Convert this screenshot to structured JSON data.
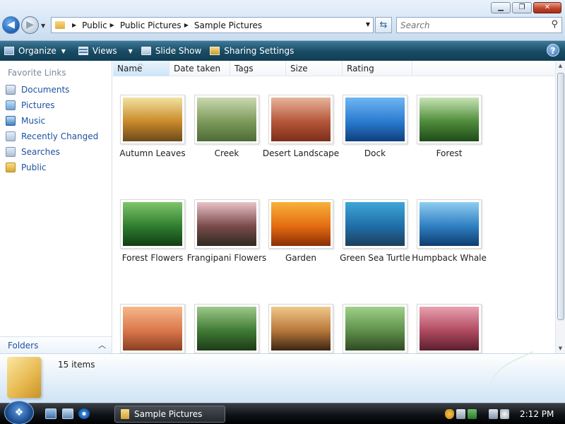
{
  "window": {
    "minimize_label": "▁",
    "maximize_label": "❐",
    "close_label": "✕"
  },
  "address": {
    "crumbs": [
      "Public",
      "Public Pictures",
      "Sample Pictures"
    ],
    "search_placeholder": "Search"
  },
  "toolbar": {
    "organize_label": "Organize",
    "views_label": "Views",
    "slideshow_label": "Slide Show",
    "sharing_label": "Sharing Settings",
    "help_label": "?"
  },
  "sidebar": {
    "header": "Favorite Links",
    "items": [
      {
        "label": "Documents",
        "icon": "documents-icon"
      },
      {
        "label": "Pictures",
        "icon": "pictures-icon"
      },
      {
        "label": "Music",
        "icon": "music-icon"
      },
      {
        "label": "Recently Changed",
        "icon": "recently-changed-icon"
      },
      {
        "label": "Searches",
        "icon": "searches-icon"
      },
      {
        "label": "Public",
        "icon": "public-folder-icon"
      }
    ],
    "folders_label": "Folders"
  },
  "columns": [
    "Name",
    "Date taken",
    "Tags",
    "Size",
    "Rating"
  ],
  "files": [
    {
      "name": "Autumn Leaves",
      "colors": [
        "#f2e3a0",
        "#c98a2a",
        "#6b4a1c"
      ]
    },
    {
      "name": "Creek",
      "colors": [
        "#c9d9b0",
        "#7c9a5a",
        "#4f6b38"
      ]
    },
    {
      "name": "Desert Landscape",
      "colors": [
        "#e8b59b",
        "#b5563a",
        "#7c2f1a"
      ]
    },
    {
      "name": "Dock",
      "colors": [
        "#6fb6f2",
        "#2a7bd0",
        "#0e3f7c"
      ]
    },
    {
      "name": "Forest",
      "colors": [
        "#c8e3b5",
        "#4e8c3a",
        "#1f4a1a"
      ]
    },
    {
      "name": "Forest Flowers",
      "colors": [
        "#7fc46a",
        "#2f7e2f",
        "#123d14"
      ]
    },
    {
      "name": "Frangipani Flowers",
      "colors": [
        "#e9c2c8",
        "#7a4b4b",
        "#2d2a20"
      ]
    },
    {
      "name": "Garden",
      "colors": [
        "#f7b23b",
        "#e46c12",
        "#8a2f05"
      ]
    },
    {
      "name": "Green Sea Turtle",
      "colors": [
        "#3fa6d8",
        "#1f6ea8",
        "#1c3f5c"
      ]
    },
    {
      "name": "Humpback Whale",
      "colors": [
        "#8ecdf0",
        "#2f7fc2",
        "#0d3c6e"
      ]
    },
    {
      "name": "",
      "colors": [
        "#f6b88a",
        "#d9774a",
        "#8a3f22"
      ]
    },
    {
      "name": "",
      "colors": [
        "#9ec98a",
        "#3f7a35",
        "#1d3a17"
      ]
    },
    {
      "name": "",
      "colors": [
        "#f0c88a",
        "#b8773a",
        "#3a2512"
      ]
    },
    {
      "name": "",
      "colors": [
        "#9fd18a",
        "#5f8f4a",
        "#2e4a22"
      ]
    },
    {
      "name": "",
      "colors": [
        "#e9a0b0",
        "#b04a60",
        "#5a1f2d"
      ]
    }
  ],
  "details": {
    "count_text": "15 items"
  },
  "taskbar": {
    "task_label": "Sample Pictures",
    "clock": "2:12 PM",
    "start_glyph": "❖"
  }
}
